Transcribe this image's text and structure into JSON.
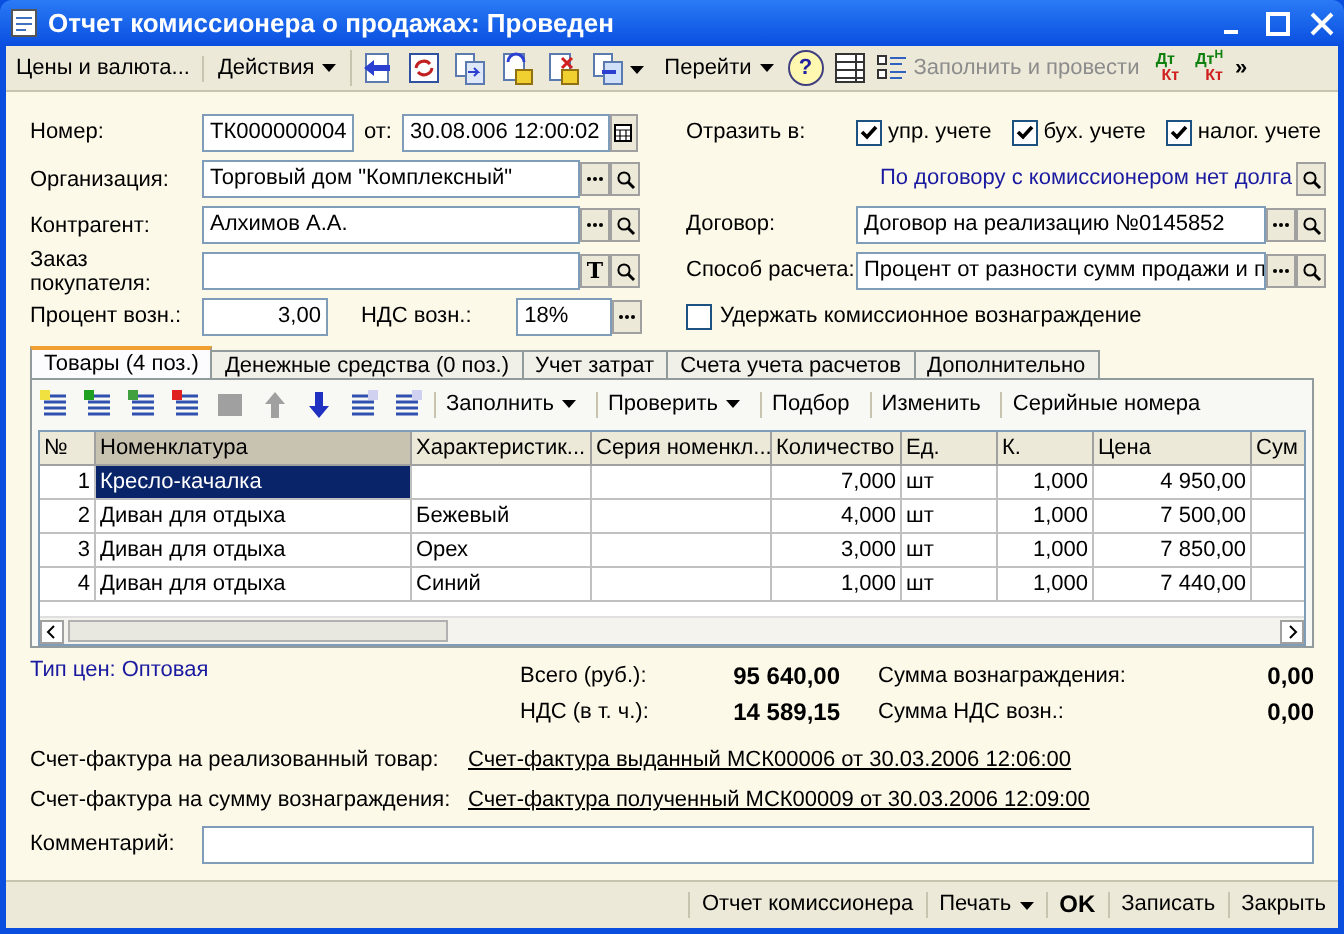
{
  "window": {
    "title": "Отчет комиссионера о продажах: Проведен"
  },
  "toolbar": {
    "items": [
      {
        "kind": "text",
        "label": "Цены и валюта..."
      },
      {
        "kind": "menu",
        "label": "Действия"
      },
      {
        "kind": "icons"
      },
      {
        "kind": "menu",
        "label": "Перейти"
      },
      {
        "kind": "help",
        "label": "?"
      },
      {
        "kind": "list"
      },
      {
        "kind": "disabled",
        "label": "Заполнить и провести"
      },
      {
        "kind": "ledger",
        "top": "Дт",
        "bottom": "Кт"
      },
      {
        "kind": "ledger",
        "top": "Дт",
        "sup": "Н",
        "bottom": "Кт"
      },
      {
        "kind": "overflow",
        "label": "»"
      }
    ]
  },
  "header": {
    "number": {
      "label": "Номер:",
      "value": "ТК000000004",
      "date_label": "от:",
      "date": "30.08.006  12:00:02"
    },
    "fields": [
      {
        "label": "Организация:",
        "value": "Торговый дом \"Комплексный\"",
        "buttons": [
          {
            "kind": "choose"
          },
          {
            "kind": "search"
          }
        ]
      },
      {
        "label": "Контрагент:",
        "value": "Алхимов А.А.",
        "buttons": [
          {
            "kind": "choose"
          },
          {
            "kind": "search"
          }
        ]
      },
      {
        "label": "Заказ покупателя:",
        "buttons": [
          {
            "kind": "text",
            "label": "T"
          },
          {
            "kind": "search"
          }
        ]
      }
    ],
    "percent": {
      "label": "Процент возн.:",
      "value": "3,00",
      "vat_label": "НДС возн.:",
      "vat": "18%"
    },
    "reflect": {
      "label": "Отразить в:",
      "options": [
        {
          "label": "упр. учете",
          "checked": true
        },
        {
          "label": "бух. учете",
          "checked": true
        },
        {
          "label": "налог. учете",
          "checked": true
        }
      ]
    },
    "debt_link": "По договору с комиссионером нет долга",
    "right_fields": [
      {
        "label": "Договор:",
        "value": "Договор на реализацию №0145852"
      },
      {
        "label": "Способ расчета:",
        "value": "Процент от разности сумм продажи и п"
      }
    ],
    "withhold": {
      "label": "Удержать комиссионное вознаграждение",
      "checked": false
    }
  },
  "tabs": [
    {
      "label": "Товары (4 поз.)",
      "selected": true
    },
    {
      "label": "Денежные средства (0 поз.)",
      "selected": false
    },
    {
      "label": "Учет затрат",
      "selected": false
    },
    {
      "label": "Счета учета расчетов",
      "selected": false
    },
    {
      "label": "Дополнительно",
      "selected": false
    }
  ],
  "table_toolbar": {
    "buttons": [
      {
        "label": "Заполнить",
        "menu": true
      },
      {
        "label": "Проверить",
        "menu": true
      },
      {
        "label": "Подбор",
        "menu": false
      },
      {
        "label": "Изменить",
        "menu": false
      },
      {
        "label": "Серийные номера",
        "menu": false
      }
    ]
  },
  "table": {
    "columns": [
      "№",
      "Номенклатура",
      "Характеристик...",
      "Серия номенкл...",
      "Количество",
      "Ед.",
      "К.",
      "Цена",
      "Сум"
    ],
    "rows": [
      {
        "n": "1",
        "item": "Кресло-качалка",
        "feature": "",
        "series": "",
        "qty": "7,000",
        "unit": "шт",
        "k": "1,000",
        "price": "4 950,00",
        "selected": true
      },
      {
        "n": "2",
        "item": "Диван для отдыха",
        "feature": "Бежевый",
        "series": "",
        "qty": "4,000",
        "unit": "шт",
        "k": "1,000",
        "price": "7 500,00",
        "selected": false
      },
      {
        "n": "3",
        "item": "Диван для отдыха",
        "feature": "Орех",
        "series": "",
        "qty": "3,000",
        "unit": "шт",
        "k": "1,000",
        "price": "7 850,00",
        "selected": false
      },
      {
        "n": "4",
        "item": "Диван для отдыха",
        "feature": "Синий",
        "series": "",
        "qty": "1,000",
        "unit": "шт",
        "k": "1,000",
        "price": "7 440,00",
        "selected": false
      }
    ]
  },
  "price_type": "Тип цен: Оптовая",
  "totals": [
    {
      "label": "Всего (руб.):",
      "value": "95 640,00",
      "label2": "Сумма вознаграждения:",
      "value2": "0,00"
    },
    {
      "label": "НДС (в т. ч.):",
      "value": "14 589,15",
      "label2": "Сумма НДС возн.:",
      "value2": "0,00"
    }
  ],
  "invoices": [
    {
      "label": "Счет-фактура на реализованный товар:",
      "link": "Счет-фактура выданный МСК00006 от 30.03.2006 12:06:00"
    },
    {
      "label": "Счет-фактура на сумму вознаграждения:",
      "link": "Счет-фактура полученный МСК00009 от 30.03.2006 12:09:00"
    }
  ],
  "comment": {
    "label": "Комментарий:"
  },
  "bottom_buttons": [
    {
      "label": "Отчет комиссионера",
      "kind": "plain"
    },
    {
      "label": "Печать",
      "kind": "menu"
    },
    {
      "label": "OK",
      "kind": "bold"
    },
    {
      "label": "Записать",
      "kind": "plain"
    },
    {
      "label": "Закрыть",
      "kind": "plain"
    }
  ]
}
